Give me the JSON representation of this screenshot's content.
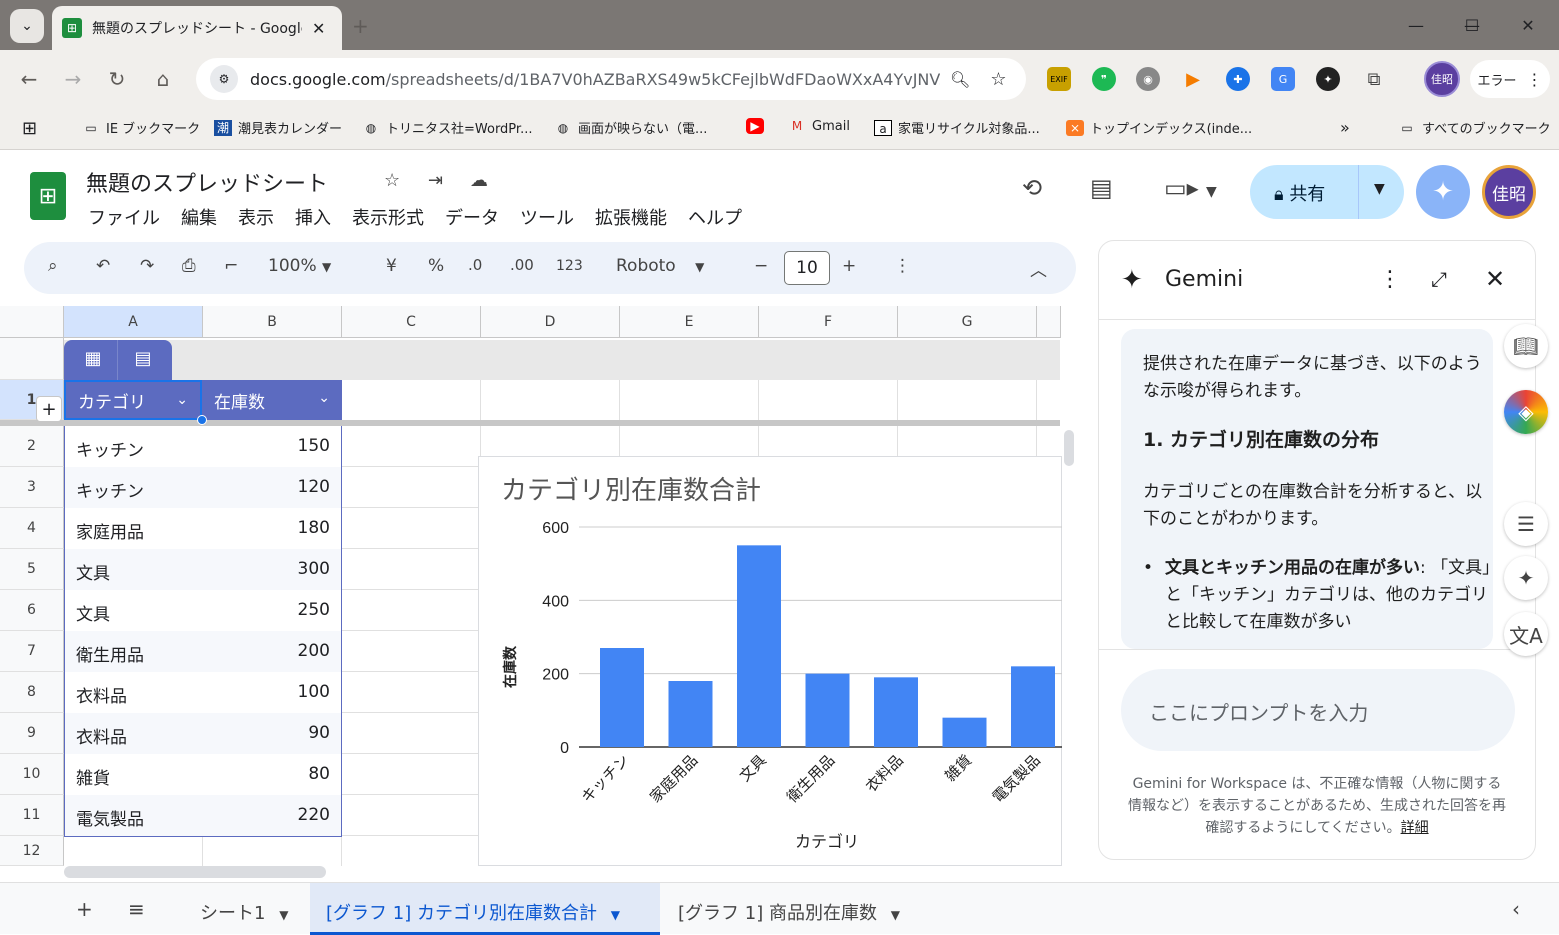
{
  "browser": {
    "tab_title": "無題のスプレッドシート - Google ス",
    "url_host": "docs.google.com",
    "url_path": "/spreadsheets/d/1BA7V0hAZBaRXS49w5kCFejlbWdFDaoWXxA4YvJNV...",
    "profile_label": "佳昭",
    "error_label": "エラー"
  },
  "bookmarks": [
    {
      "label": "IE ブックマーク",
      "icon": "folder-icon"
    },
    {
      "label": "潮見表カレンダー",
      "icon": "tide-icon"
    },
    {
      "label": "トリニタス社=WordPr...",
      "icon": "globe-icon"
    },
    {
      "label": "画面が映らない（電...",
      "icon": "globe-icon"
    },
    {
      "label": "",
      "icon": "youtube-icon"
    },
    {
      "label": "Gmail",
      "icon": "gmail-icon"
    },
    {
      "label": "家電リサイクル対象品...",
      "icon": "amazon-icon"
    },
    {
      "label": "トップインデックス(inde...",
      "icon": "xampp-icon"
    }
  ],
  "all_bookmarks": "すべてのブックマーク",
  "sheets": {
    "title": "無題のスプレッドシート",
    "menu": [
      "ファイル",
      "編集",
      "表示",
      "挿入",
      "表示形式",
      "データ",
      "ツール",
      "拡張機能",
      "ヘルプ"
    ],
    "share_label": "共有",
    "avatar_label": "佳昭"
  },
  "toolbar": {
    "zoom": "100%",
    "currency": "¥",
    "percent": "%",
    "dec_decrease": ".0",
    "dec_increase": ".00",
    "number_format": "123",
    "font": "Roboto",
    "font_size": "10"
  },
  "grid": {
    "columns": [
      "A",
      "B",
      "C",
      "D",
      "E",
      "F",
      "G"
    ],
    "rows": [
      "1",
      "2",
      "3",
      "4",
      "5",
      "6",
      "7",
      "8",
      "9",
      "10",
      "11",
      "12"
    ],
    "headers": [
      "カテゴリ",
      "在庫数"
    ],
    "data": [
      [
        "キッチン",
        "150"
      ],
      [
        "キッチン",
        "120"
      ],
      [
        "家庭用品",
        "180"
      ],
      [
        "文具",
        "300"
      ],
      [
        "文具",
        "250"
      ],
      [
        "衛生用品",
        "200"
      ],
      [
        "衣料品",
        "100"
      ],
      [
        "衣料品",
        "90"
      ],
      [
        "雑貨",
        "80"
      ],
      [
        "電気製品",
        "220"
      ]
    ]
  },
  "chart_data": {
    "type": "bar",
    "title": "カテゴリ別在庫数合計",
    "xlabel": "カテゴリ",
    "ylabel": "在庫数",
    "categories": [
      "キッチン",
      "家庭用品",
      "文具",
      "衛生用品",
      "衣料品",
      "雑貨",
      "電気製品"
    ],
    "values": [
      270,
      180,
      550,
      200,
      190,
      80,
      220
    ],
    "ylim": [
      0,
      600
    ],
    "yticks": [
      "0",
      "200",
      "400",
      "600"
    ],
    "grid": true,
    "bar_color": "#4285f4"
  },
  "gemini": {
    "title": "Gemini",
    "intro": "提供された在庫データに基づき、以下のような示唆が得られます。",
    "heading": "1. カテゴリ別在庫数の分布",
    "para": "カテゴリごとの在庫数合計を分析すると、以下のことがわかります。",
    "bullet_bold": "文具とキッチン用品の在庫が多い",
    "bullet_text": "「文具」と「キッチン」カテゴリは、他のカテゴリと比較して在庫数が多い",
    "prompt_placeholder": "ここにプロンプトを入力",
    "disclaimer": "Gemini for Workspace は、不正確な情報（人物に関する情報など）を表示することがあるため、生成された回答を再確認するようにしてください。",
    "details_link": "詳細"
  },
  "sheet_tabs": [
    {
      "label": "シート1",
      "active": false
    },
    {
      "label": "[グラフ 1] カテゴリ別在庫数合計",
      "active": true
    },
    {
      "label": "[グラフ 1] 商品別在庫数",
      "active": false
    }
  ]
}
